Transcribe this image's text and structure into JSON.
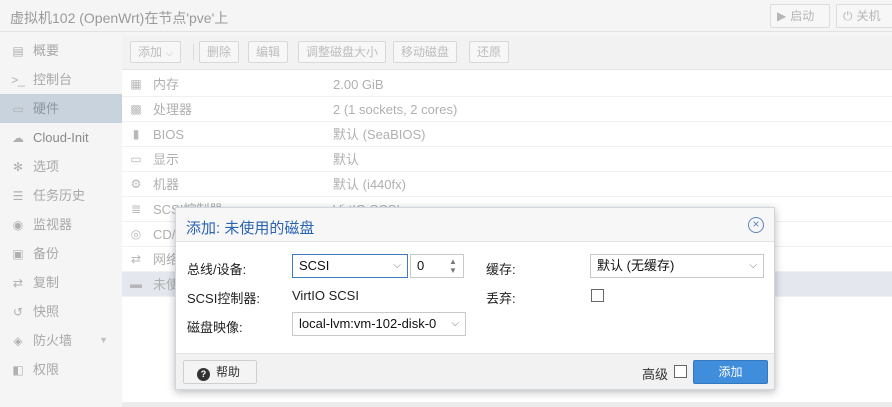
{
  "window": {
    "title": "虚拟机102 (OpenWrt)在节点'pve'上",
    "start_label": "启动",
    "shutdown_label": "关机"
  },
  "sidebar": {
    "items": [
      {
        "label": "概要",
        "icon": "book-icon"
      },
      {
        "label": "控制台",
        "icon": "terminal-icon"
      },
      {
        "label": "硬件",
        "icon": "monitor-icon"
      },
      {
        "label": "Cloud-Init",
        "icon": "cloud-icon"
      },
      {
        "label": "选项",
        "icon": "gear-icon"
      },
      {
        "label": "任务历史",
        "icon": "list-icon"
      },
      {
        "label": "监视器",
        "icon": "eye-icon"
      },
      {
        "label": "备份",
        "icon": "floppy-icon"
      },
      {
        "label": "复制",
        "icon": "retweet-icon"
      },
      {
        "label": "快照",
        "icon": "history-icon"
      },
      {
        "label": "防火墙",
        "icon": "shield-icon"
      },
      {
        "label": "权限",
        "icon": "unlock-icon"
      }
    ]
  },
  "toolbar": {
    "add": "添加",
    "delete": "删除",
    "edit": "编辑",
    "resize": "调整磁盘大小",
    "move": "移动磁盘",
    "revert": "还原"
  },
  "hardware": {
    "rows": [
      {
        "key": "内存",
        "value": "2.00 GiB",
        "icon": "memory-icon"
      },
      {
        "key": "处理器",
        "value": "2 (1 sockets, 2 cores)",
        "icon": "cpu-icon"
      },
      {
        "key": "BIOS",
        "value": "默认 (SeaBIOS)",
        "icon": "microchip-icon"
      },
      {
        "key": "显示",
        "value": "默认",
        "icon": "desktop-icon"
      },
      {
        "key": "机器",
        "value": "默认 (i440fx)",
        "icon": "cogs-icon"
      },
      {
        "key": "SCSI控制器",
        "value": "VirtIO SCSI",
        "icon": "database-icon"
      },
      {
        "key": "CD/DVD驱动器",
        "value": "",
        "icon": "cdrom-icon"
      },
      {
        "key": "网络设备",
        "value": "",
        "icon": "exchange-icon"
      },
      {
        "key": "未使用的磁盘",
        "value": "",
        "icon": "hdd-icon"
      }
    ]
  },
  "dialog": {
    "title": "添加: 未使用的磁盘",
    "bus_label": "总线/设备:",
    "bus_value": "SCSI",
    "device_value": "0",
    "cache_label": "缓存:",
    "cache_value": "默认 (无缓存)",
    "scsi_ctrl_label": "SCSI控制器:",
    "scsi_ctrl_value": "VirtIO SCSI",
    "discard_label": "丢弃:",
    "disk_image_label": "磁盘映像:",
    "disk_image_value": "local-lvm:vm-102-disk-0",
    "help_label": "帮助",
    "advanced_label": "高级",
    "add_label": "添加"
  }
}
